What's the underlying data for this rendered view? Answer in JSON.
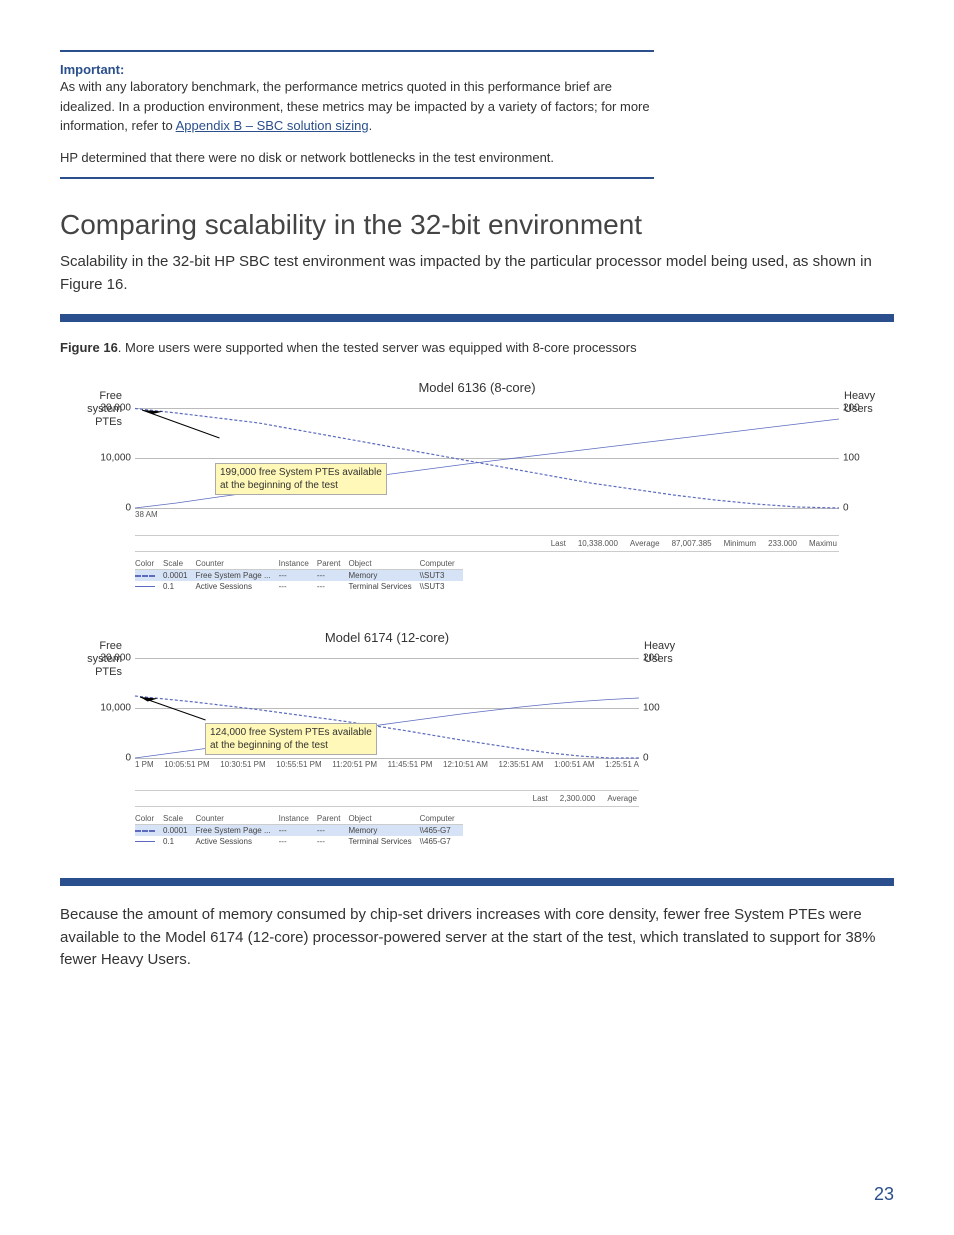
{
  "important": {
    "label": "Important:",
    "text": "As with any laboratory benchmark, the performance metrics quoted in this performance brief are idealized. In a production environment, these metrics may be impacted by a variety of factors; for more information, refer to ",
    "link_text": "Appendix B – SBC solution sizing",
    "after_link": ".",
    "followup": "HP determined that there were no disk or network bottlenecks in the test environment."
  },
  "section": {
    "title": "Comparing scalability in the 32-bit environment",
    "intro": "Scalability in the 32-bit HP SBC test environment was impacted by the particular processor model being used, as shown in Figure 16."
  },
  "figure": {
    "label": "Figure 16",
    "caption": ". More users were supported when the tested server was equipped with 8-core processors"
  },
  "chart_data": [
    {
      "type": "line",
      "title": "Model 6136 (8-core)",
      "left_axis": {
        "label_line1": "Free",
        "label_line2": "system PTEs",
        "ticks": [
          "20,000",
          "10,000",
          "0"
        ]
      },
      "right_axis": {
        "label_line1": "Heavy",
        "label_line2": "Users",
        "ticks": [
          "200",
          "100",
          "0"
        ]
      },
      "x_ticks": [
        "38 AM"
      ],
      "callout": {
        "line1": "199,000 free System PTEs available",
        "line2": "at the beginning of the test"
      },
      "series": [
        {
          "name": "Free System Page ...",
          "style": "dashed",
          "values": [
            19900,
            19000,
            18000,
            17000,
            15500,
            14000,
            12500,
            11000,
            9500,
            8000,
            6500,
            5000,
            3800,
            2600,
            1600,
            800,
            200,
            0
          ]
        },
        {
          "name": "Active Sessions",
          "style": "solid",
          "values": [
            0,
            10,
            22,
            33,
            44,
            55,
            66,
            77,
            88,
            98,
            108,
            118,
            128,
            138,
            148,
            158,
            168,
            178
          ]
        }
      ],
      "stats": {
        "Last": "10,338.000",
        "Average": "87,007.385",
        "Minimum": "233.000",
        "Maximu": ""
      },
      "legend": {
        "headers": [
          "Color",
          "Scale",
          "Counter",
          "Instance",
          "Parent",
          "Object",
          "Computer"
        ],
        "rows": [
          [
            "dash",
            "0.0001",
            "Free System Page ...",
            "---",
            "---",
            "Memory",
            "\\\\SUT3"
          ],
          [
            "solid",
            "0.1",
            "Active Sessions",
            "---",
            "---",
            "Terminal Services",
            "\\\\SUT3"
          ]
        ]
      }
    },
    {
      "type": "line",
      "title": "Model 6174 (12-core)",
      "left_axis": {
        "label_line1": "Free",
        "label_line2": "system PTEs",
        "ticks": [
          "20,000",
          "10,000",
          "0"
        ]
      },
      "right_axis": {
        "label_line1": "Heavy",
        "label_line2": "Users",
        "ticks": [
          "200",
          "100",
          "0"
        ]
      },
      "x_ticks": [
        "1 PM",
        "10:05:51 PM",
        "10:30:51 PM",
        "10:55:51 PM",
        "11:20:51 PM",
        "11:45:51 PM",
        "12:10:51 AM",
        "12:35:51 AM",
        "1:00:51 AM",
        "1:25:51 A"
      ],
      "callout": {
        "line1": "124,000 free System PTEs available",
        "line2": "at the beginning of the test"
      },
      "series": [
        {
          "name": "Free System Page ...",
          "style": "dashed",
          "values": [
            12400,
            11800,
            11200,
            10500,
            9800,
            9000,
            8200,
            7400,
            6500,
            5600,
            4600,
            3600,
            2700,
            1800,
            1000,
            400,
            0,
            0
          ]
        },
        {
          "name": "Active Sessions",
          "style": "solid",
          "values": [
            0,
            8,
            16,
            24,
            32,
            40,
            48,
            56,
            64,
            72,
            80,
            88,
            95,
            102,
            108,
            113,
            117,
            120
          ]
        }
      ],
      "stats": {
        "Last": "2,300.000",
        "Average": ""
      },
      "legend": {
        "headers": [
          "Color",
          "Scale",
          "Counter",
          "Instance",
          "Parent",
          "Object",
          "Computer"
        ],
        "rows": [
          [
            "dash",
            "0.0001",
            "Free System Page ...",
            "---",
            "---",
            "Memory",
            "\\\\465-G7"
          ],
          [
            "solid",
            "0.1",
            "Active Sessions",
            "---",
            "---",
            "Terminal Services",
            "\\\\465-G7"
          ]
        ]
      }
    }
  ],
  "conclusion": "Because the amount of memory consumed by chip-set drivers increases with core density, fewer free System PTEs were available to the Model 6174 (12-core) processor-powered server at the start of the test, which translated to support for 38% fewer Heavy Users.",
  "page_number": "23"
}
